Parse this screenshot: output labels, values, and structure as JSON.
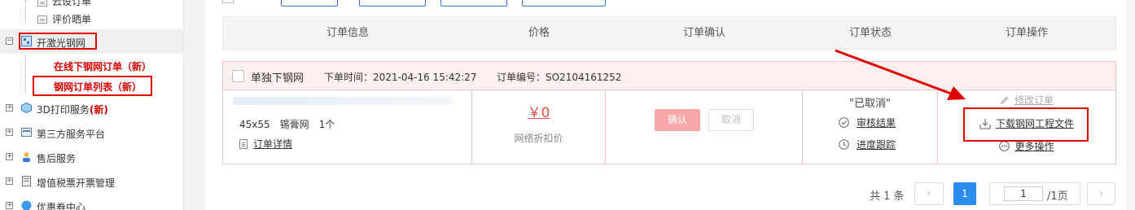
{
  "sidebar": {
    "items": [
      {
        "label": "云设订单",
        "type": "sub"
      },
      {
        "label": "评价晒单",
        "type": "sub"
      },
      {
        "label": "开激光钢网",
        "type": "parent"
      },
      {
        "label": "在线下钢网订单（新）",
        "type": "sub-link"
      },
      {
        "label": "钢网订单列表（新）",
        "type": "sub-link"
      },
      {
        "label": "3D打印服务",
        "badge": "(新)",
        "type": "parent"
      },
      {
        "label": "第三方服务平台",
        "type": "parent"
      },
      {
        "label": "售后服务",
        "type": "parent"
      },
      {
        "label": "增值税票开票管理",
        "type": "parent"
      },
      {
        "label": "优惠券中心",
        "type": "parent"
      }
    ],
    "expand_minus": "−",
    "expand_plus": "+"
  },
  "table": {
    "headers": [
      "订单信息",
      "价格",
      "订单确认",
      "订单状态",
      "订单操作"
    ]
  },
  "order": {
    "title": "单独下钢网",
    "time_label": "下单时间：2021-04-16 15:42:27",
    "number_label": "订单编号：SO2104161252",
    "spec": "45x55　锡膏网　1个",
    "detail_link": "订单详情",
    "price": "￥0",
    "price_note": "网络折扣价",
    "confirm_btn": "确认",
    "cancel_btn": "取消",
    "status": "\"已取消\"",
    "audit_link": "审核结果",
    "progress_link": "进度跟踪",
    "modify_link": "修改订单",
    "download_link": "下载钢网工程文件",
    "more_link": "更多操作"
  },
  "pager": {
    "total": "共 1 条",
    "prev": "‹",
    "current": "1",
    "input_value": "1",
    "pages_suffix": "/1页",
    "next": "›"
  },
  "colors": {
    "annotation_red": "#e00000",
    "price_red": "#e94c4c",
    "pager_blue": "#2d8cf0",
    "confirm_pink": "#f6a7a7"
  }
}
